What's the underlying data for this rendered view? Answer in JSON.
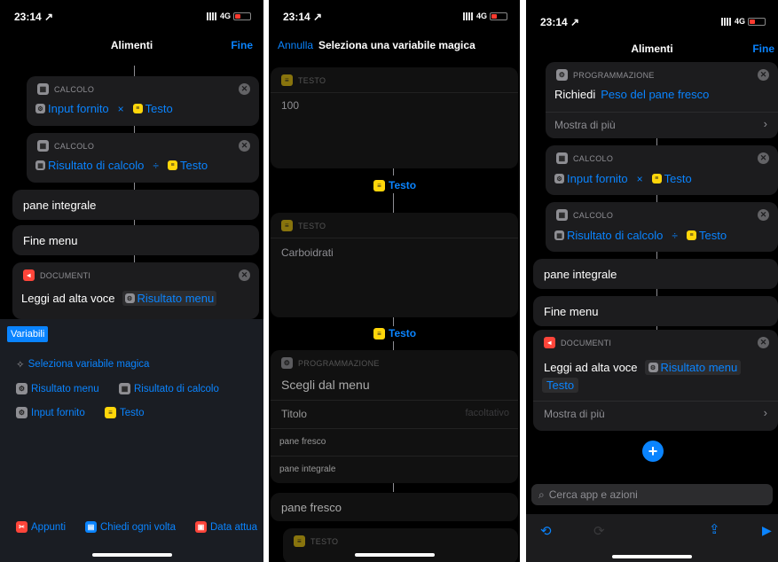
{
  "panel1": {
    "status": {
      "time": "23:14 ↗",
      "network": "4G"
    },
    "nav": {
      "title": "Alimenti",
      "done": "Fine"
    },
    "calc1": {
      "header": "CALCOLO",
      "input": "Input fornito",
      "op": "×",
      "var": "Testo"
    },
    "calc2": {
      "header": "CALCOLO",
      "input": "Risultato di calcolo",
      "op": "÷",
      "var": "Testo"
    },
    "pane_integrale": "pane integrale",
    "fine_menu": "Fine menu",
    "documenti": {
      "header": "DOCUMENTI",
      "action": "Leggi ad alta voce",
      "token": "Risultato menu"
    },
    "variabili": {
      "label": "Variabili",
      "magic": "Seleziona variabile magica",
      "items": [
        "Risultato menu",
        "Risultato di calcolo",
        "Input fornito",
        "Testo"
      ],
      "bottom": [
        "Appunti",
        "Chiedi ogni volta",
        "Data attua"
      ]
    }
  },
  "panel2": {
    "status": {
      "time": "23:14 ↗",
      "network": "4G"
    },
    "nav": {
      "cancel": "Annulla",
      "title": "Seleziona una variabile magica"
    },
    "testo1": {
      "header": "TESTO",
      "value": "100",
      "output": "Testo"
    },
    "testo2": {
      "header": "TESTO",
      "value": "Carboidrati",
      "output": "Testo"
    },
    "menu": {
      "header": "PROGRAMMAZIONE",
      "action": "Scegli dal menu",
      "title_label": "Titolo",
      "title_placeholder": "facoltativo",
      "options": [
        "pane fresco",
        "pane integrale"
      ]
    },
    "pane_fresco": "pane fresco",
    "testo3": {
      "header": "TESTO"
    }
  },
  "panel3": {
    "status": {
      "time": "23:14 ↗",
      "network": "4G"
    },
    "nav": {
      "title": "Alimenti",
      "done": "Fine"
    },
    "prog": {
      "header": "PROGRAMMAZIONE",
      "action": "Richiedi",
      "token": "Peso del pane fresco",
      "more": "Mostra di più"
    },
    "calc1": {
      "header": "CALCOLO",
      "input": "Input fornito",
      "op": "×",
      "var": "Testo"
    },
    "calc2": {
      "header": "CALCOLO",
      "input": "Risultato di calcolo",
      "op": "÷",
      "var": "Testo"
    },
    "pane_integrale": "pane integrale",
    "fine_menu": "Fine menu",
    "documenti": {
      "header": "DOCUMENTI",
      "action": "Leggi ad alta voce",
      "token": "Risultato menu",
      "token2": "Testo",
      "more": "Mostra di più"
    },
    "search_placeholder": "Cerca app e azioni"
  },
  "colors": {
    "accent": "#0a84ff",
    "card": "#1c1c1e",
    "bg": "#000000"
  }
}
